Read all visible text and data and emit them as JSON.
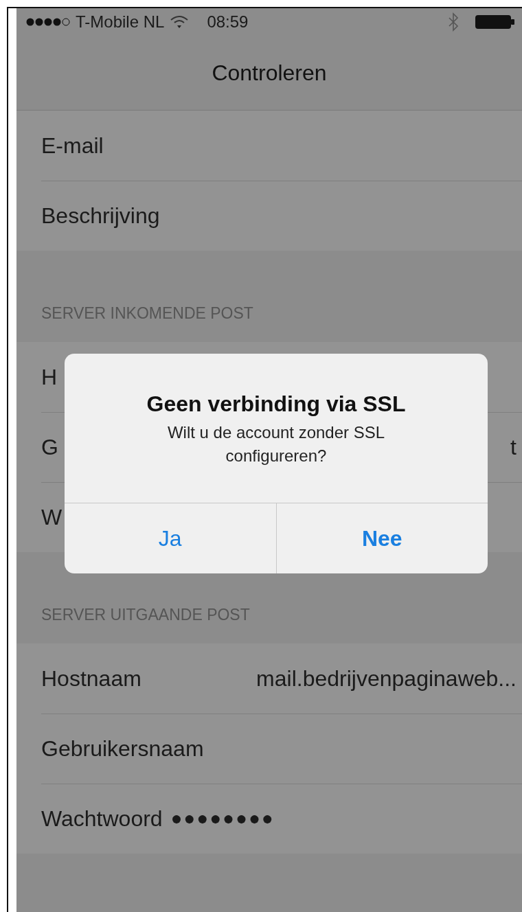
{
  "status_bar": {
    "carrier": "T-Mobile NL",
    "time": "08:59"
  },
  "nav": {
    "title": "Controleren"
  },
  "sections": [
    {
      "rows": [
        {
          "label": "E-mail"
        },
        {
          "label": "Beschrijving"
        }
      ]
    },
    {
      "header": "SERVER INKOMENDE POST",
      "rows": [
        {
          "label": "H"
        },
        {
          "label": "G",
          "value": "t"
        },
        {
          "label": "W"
        }
      ]
    },
    {
      "header": "SERVER UITGAANDE POST",
      "rows": [
        {
          "label": "Hostnaam",
          "value": "mail.bedrijvenpaginaweb..."
        },
        {
          "label": "Gebruikersnaam"
        },
        {
          "label": "Wachtwoord",
          "value": "●●●●●●●●",
          "kind": "password"
        }
      ]
    }
  ],
  "alert": {
    "title": "Geen verbinding via SSL",
    "message": "Wilt u de account zonder SSL configureren?",
    "buttons": [
      {
        "label": "Ja",
        "kind": "normal"
      },
      {
        "label": "Nee",
        "kind": "preferred"
      }
    ]
  }
}
